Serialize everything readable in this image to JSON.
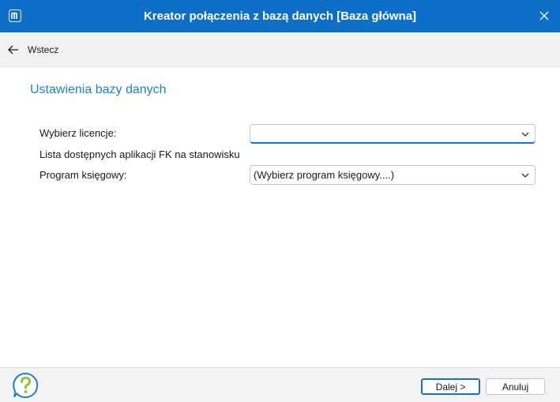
{
  "window": {
    "title": "Kreator połączenia z bazą danych [Baza główna]",
    "accent_color": "#0d6fc8",
    "logo_icon": "app-logo-icon",
    "close_icon": "close-icon"
  },
  "nav": {
    "back_label": "Wstecz",
    "back_icon": "arrow-left-icon"
  },
  "main": {
    "section_title": "Ustawienia bazy danych",
    "license": {
      "label": "Wybierz licencje:",
      "value": ""
    },
    "apps_list_label": "Lista dostępnych aplikacji FK na stanowisku",
    "accounting_program": {
      "label": "Program księgowy:",
      "value": "(Wybierz program księgowy....)"
    }
  },
  "footer": {
    "help_icon": "help-icon",
    "next_label": "Dalej >",
    "cancel_label": "Anuluj"
  }
}
